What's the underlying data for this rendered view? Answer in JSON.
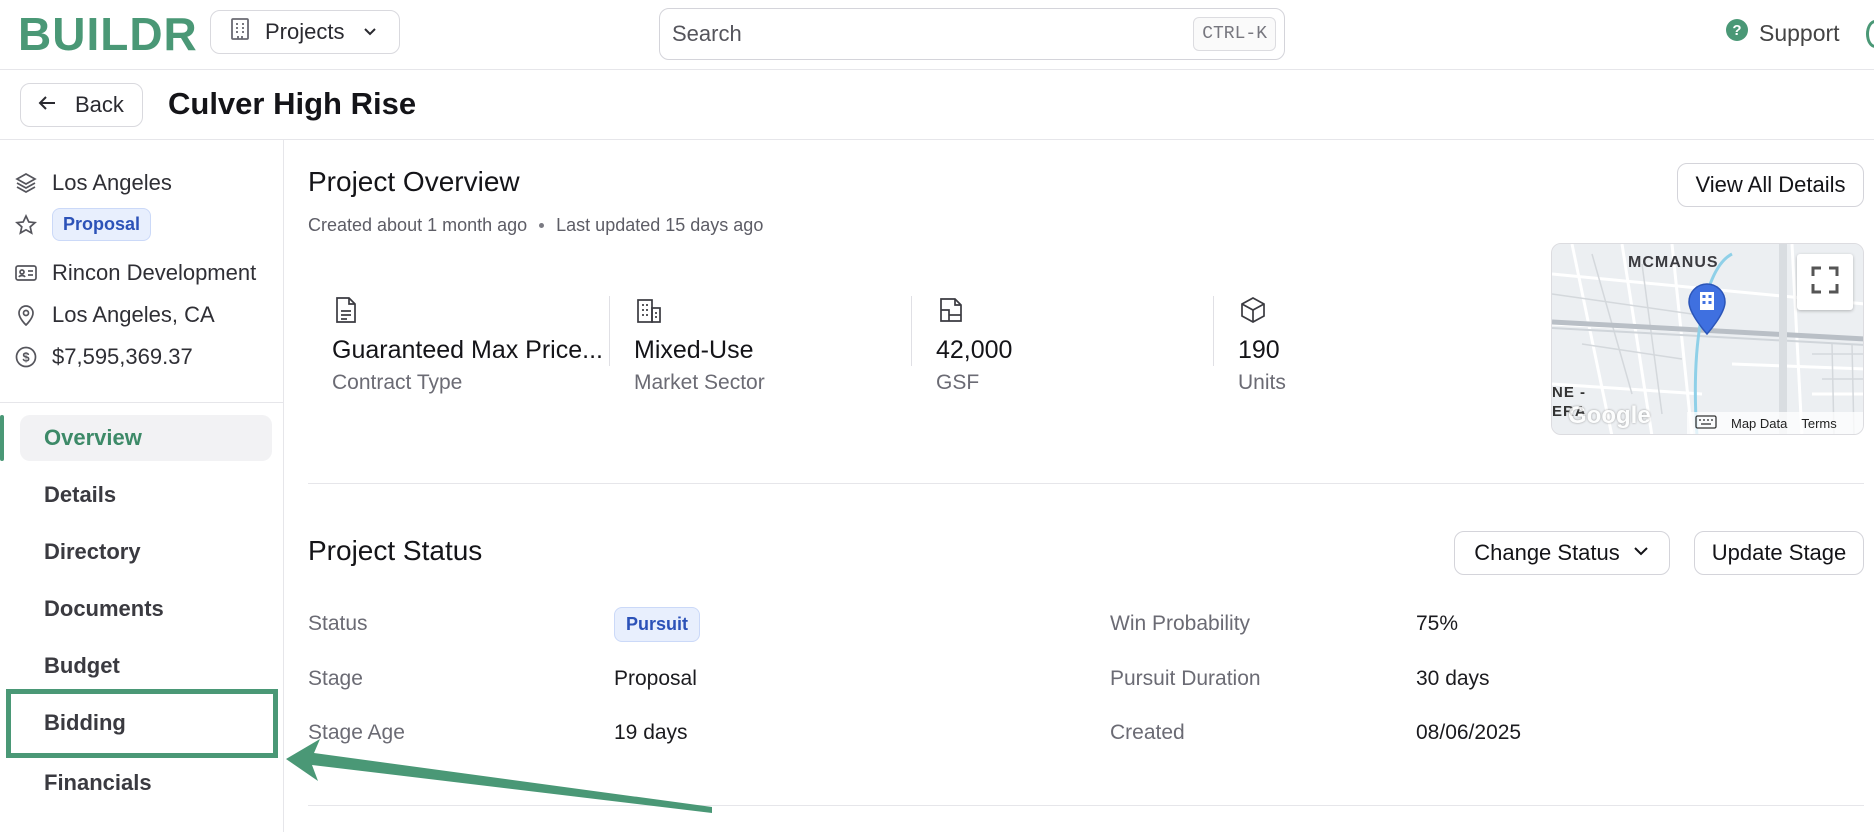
{
  "app": {
    "logo": "BUILDR",
    "projects_label": "Projects",
    "search_placeholder": "Search",
    "search_shortcut": "CTRL-K",
    "support_label": "Support",
    "accent_color": "#4a9876"
  },
  "header": {
    "back_label": "Back",
    "title": "Culver High Rise"
  },
  "sidebar": {
    "meta": {
      "region": "Los Angeles",
      "stage_badge": "Proposal",
      "company": "Rincon Development",
      "location": "Los Angeles, CA",
      "amount": "$7,595,369.37"
    },
    "nav": [
      "Overview",
      "Details",
      "Directory",
      "Documents",
      "Budget",
      "Bidding",
      "Financials"
    ],
    "active_item": "Overview",
    "highlighted_item": "Bidding"
  },
  "overview": {
    "title": "Project Overview",
    "created": "Created about 1 month ago",
    "updated": "Last updated 15 days ago",
    "view_all_label": "View All Details",
    "stats": [
      {
        "icon": "document-icon",
        "value": "Guaranteed Max Price...",
        "label": "Contract Type"
      },
      {
        "icon": "building-icon",
        "value": "Mixed-Use",
        "label": "Market Sector"
      },
      {
        "icon": "floorplan-icon",
        "value": "42,000",
        "label": "GSF"
      },
      {
        "icon": "cube-icon",
        "value": "190",
        "label": "Units"
      }
    ],
    "map": {
      "place_label": "MCMANUS",
      "edge_label_1": "NE -",
      "edge_label_2": "ERA",
      "provider": "Google",
      "map_data_label": "Map Data",
      "terms_label": "Terms"
    }
  },
  "status": {
    "title": "Project Status",
    "change_status_label": "Change Status",
    "update_stage_label": "Update Stage",
    "left": {
      "status_label": "Status",
      "status_value": "Pursuit",
      "stage_label": "Stage",
      "stage_value": "Proposal",
      "stage_age_label": "Stage Age",
      "stage_age_value": "19 days"
    },
    "right": {
      "win_label": "Win Probability",
      "win_value": "75%",
      "duration_label": "Pursuit Duration",
      "duration_value": "30 days",
      "created_label": "Created",
      "created_value": "08/06/2025"
    }
  }
}
